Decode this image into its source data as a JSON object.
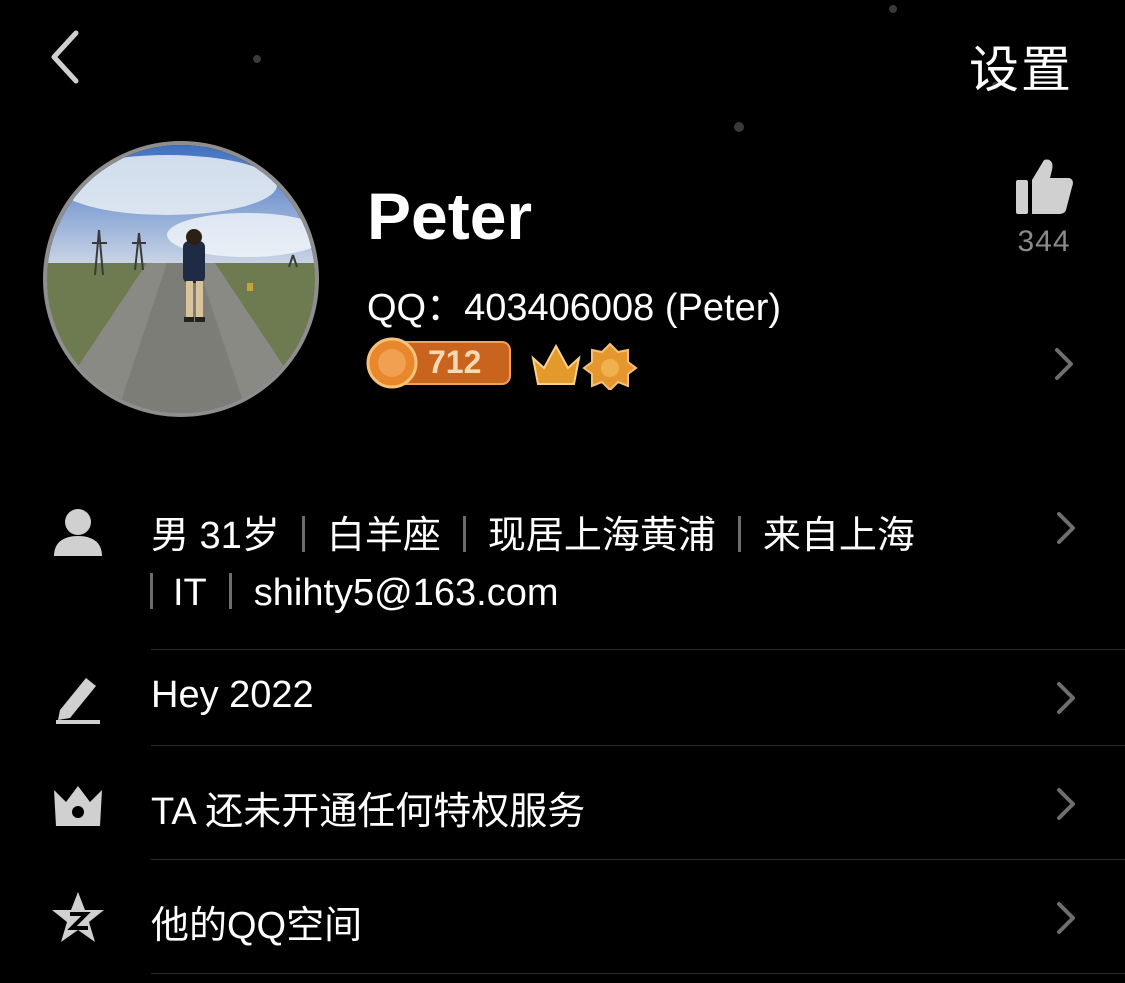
{
  "header": {
    "back_icon": "chevron-left-icon",
    "settings_label": "设置"
  },
  "profile": {
    "name": "Peter",
    "qq_line": "QQ：403406008 (Peter)",
    "level_badge": "712",
    "like_count": "344",
    "avatar_description": "photo"
  },
  "info": {
    "gender_age": "男 31岁",
    "zodiac": "白羊座",
    "residence": "现居上海黄浦",
    "hometown": "来自上海",
    "industry": "IT",
    "email": "shihty5@163.com"
  },
  "rows": {
    "signature": "Hey 2022",
    "privilege": "TA 还未开通任何特权服务",
    "qzone": "他的QQ空间"
  },
  "colors": {
    "background": "#000000",
    "text": "#ffffff",
    "muted": "#8a8a8a",
    "chevron": "#6e6e6e",
    "badge_orange": "#e07a2a"
  }
}
